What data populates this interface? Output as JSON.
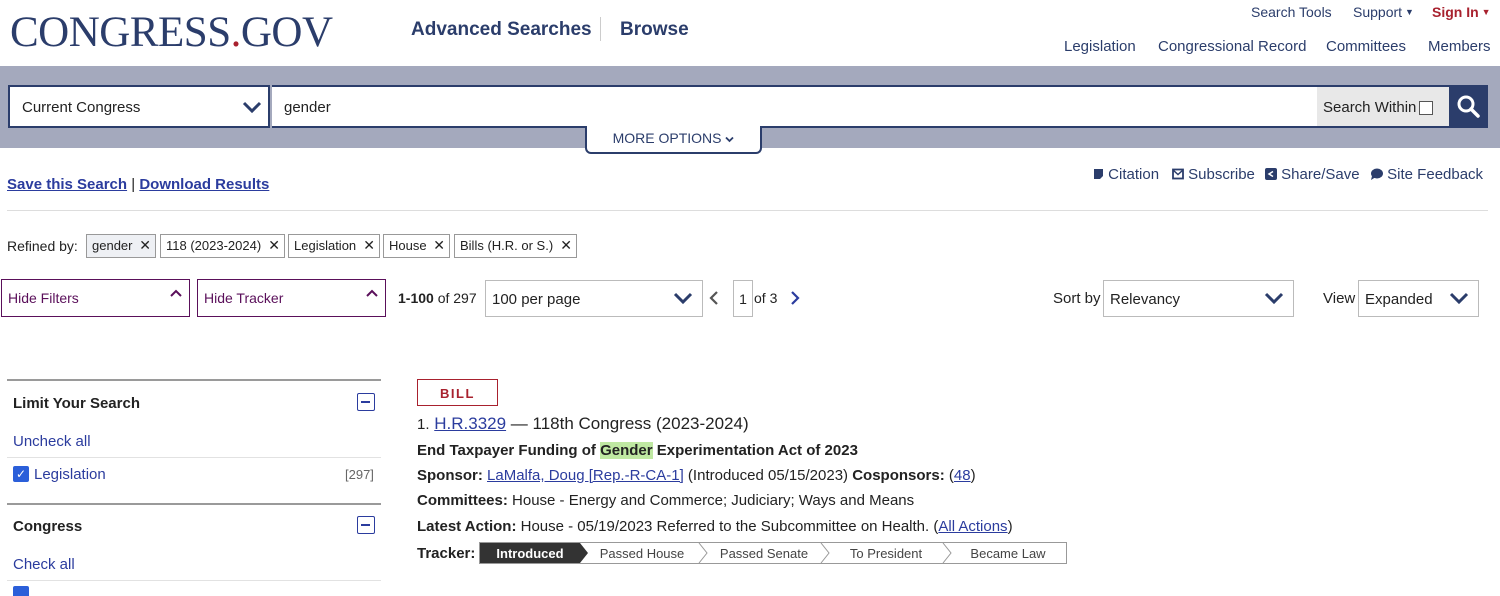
{
  "header": {
    "logo_main": "CONGRESS",
    "logo_dot": ".",
    "logo_gov": "GOV",
    "nav": [
      "Advanced Searches",
      "Browse"
    ],
    "utility": {
      "search_tools": "Search Tools",
      "support": "Support",
      "sign_in": "Sign In"
    },
    "subnav": [
      "Legislation",
      "Congressional Record",
      "Committees",
      "Members"
    ]
  },
  "search": {
    "congress_select": "Current Congress",
    "query": "gender",
    "search_within": "Search Within",
    "more_options": "MORE OPTIONS"
  },
  "actions": {
    "save_search": "Save this Search",
    "separator": "|",
    "download": "Download Results"
  },
  "tools": {
    "citation": "Citation",
    "subscribe": "Subscribe",
    "share": "Share/Save",
    "feedback": "Site Feedback"
  },
  "refined": {
    "label": "Refined by:",
    "chips": [
      "gender",
      "118 (2023-2024)",
      "Legislation",
      "House",
      "Bills (H.R. or S.)"
    ]
  },
  "controls": {
    "hide_filters": "Hide Filters",
    "hide_tracker": "Hide Tracker",
    "range": "1-100",
    "of_total": "of 297",
    "per_page": "100 per page",
    "page": "1",
    "of_pages": "of 3",
    "sort_label": "Sort by",
    "sort_value": "Relevancy",
    "view_label": "View",
    "view_value": "Expanded"
  },
  "facets": {
    "limit_title": "Limit Your Search",
    "uncheck_all": "Uncheck all",
    "legislation_label": "Legislation",
    "legislation_count": "[297]",
    "congress_title": "Congress",
    "check_all": "Check all"
  },
  "result": {
    "badge": "BILL",
    "number": "1.",
    "bill_id": "H.R.3329",
    "congress": " — 118th Congress (2023-2024)",
    "title_pre": "End Taxpayer Funding of ",
    "title_highlight": "Gender",
    "title_post": " Experimentation Act of 2023",
    "sponsor_label": "Sponsor:",
    "sponsor": "LaMalfa, Doug [Rep.-R-CA-1]",
    "introduced": " (Introduced 05/15/2023) ",
    "cosponsors_label": "Cosponsors:",
    "cosponsors_open": " (",
    "cosponsors": "48",
    "cosponsors_close": ")",
    "committees_label": "Committees:",
    "committees": " House - Energy and Commerce; Judiciary; Ways and Means",
    "latest_label": "Latest Action:",
    "latest": " House - 05/19/2023 Referred to the Subcommittee on Health. (",
    "all_actions": "All Actions",
    "latest_close": ")",
    "tracker_label": "Tracker:",
    "tracker_steps": [
      "Introduced",
      "Passed House",
      "Passed Senate",
      "To President",
      "Became Law"
    ],
    "tracker_current": "Introduced"
  }
}
